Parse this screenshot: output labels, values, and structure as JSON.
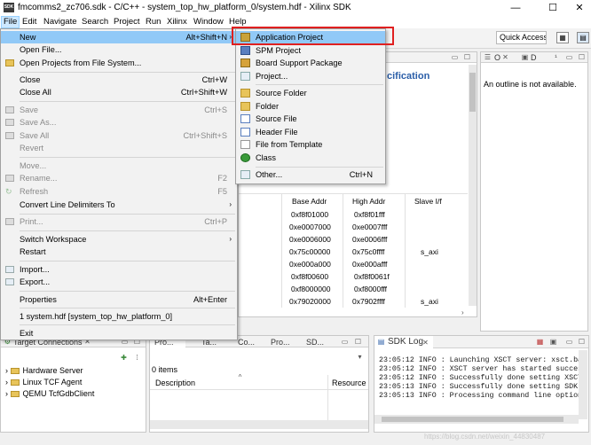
{
  "window": {
    "app_icon": "SDK",
    "title": "fmcomms2_zc706.sdk - C/C++ - system_top_hw_platform_0/system.hdf - Xilinx SDK",
    "minimize": "—",
    "maximize": "☐",
    "close": "✕"
  },
  "menubar": [
    "File",
    "Edit",
    "Navigate",
    "Search",
    "Project",
    "Run",
    "Xilinx",
    "Window",
    "Help"
  ],
  "toolbar": {
    "quick_access_placeholder": "Quick Access"
  },
  "file_menu": {
    "items": [
      {
        "label": "New",
        "shortcut": "Alt+Shift+N",
        "submenu": true,
        "highlighted": true
      },
      {
        "label": "Open File...",
        "shortcut": ""
      },
      {
        "label": "Open Projects from File System...",
        "shortcut": ""
      },
      {
        "label": "Close",
        "shortcut": "Ctrl+W"
      },
      {
        "label": "Close All",
        "shortcut": "Ctrl+Shift+W"
      },
      {
        "label": "Save",
        "shortcut": "Ctrl+S",
        "disabled": true
      },
      {
        "label": "Save As...",
        "shortcut": "",
        "disabled": true
      },
      {
        "label": "Save All",
        "shortcut": "Ctrl+Shift+S",
        "disabled": true
      },
      {
        "label": "Revert",
        "shortcut": "",
        "disabled": true
      },
      {
        "label": "Move...",
        "shortcut": "",
        "disabled": true
      },
      {
        "label": "Rename...",
        "shortcut": "F2",
        "disabled": true
      },
      {
        "label": "Refresh",
        "shortcut": "F5",
        "disabled": true
      },
      {
        "label": "Convert Line Delimiters To",
        "shortcut": "",
        "submenu": true
      },
      {
        "label": "Print...",
        "shortcut": "Ctrl+P",
        "disabled": true
      },
      {
        "label": "Switch Workspace",
        "shortcut": "",
        "submenu": true
      },
      {
        "label": "Restart",
        "shortcut": ""
      },
      {
        "label": "Import...",
        "shortcut": ""
      },
      {
        "label": "Export...",
        "shortcut": ""
      },
      {
        "label": "Properties",
        "shortcut": "Alt+Enter"
      },
      {
        "label": "1 system.hdf  [system_top_hw_platform_0]",
        "shortcut": ""
      },
      {
        "label": "Exit",
        "shortcut": ""
      }
    ]
  },
  "new_menu": {
    "items": [
      {
        "label": "Application Project",
        "shortcut": "",
        "highlighted": true
      },
      {
        "label": "SPM Project",
        "shortcut": ""
      },
      {
        "label": "Board Support Package",
        "shortcut": ""
      },
      {
        "label": "Project...",
        "shortcut": ""
      },
      {
        "label": "Source Folder",
        "shortcut": ""
      },
      {
        "label": "Folder",
        "shortcut": ""
      },
      {
        "label": "Source File",
        "shortcut": ""
      },
      {
        "label": "Header File",
        "shortcut": ""
      },
      {
        "label": "File from Template",
        "shortcut": ""
      },
      {
        "label": "Class",
        "shortcut": ""
      },
      {
        "label": "Other...",
        "shortcut": "Ctrl+N"
      }
    ]
  },
  "editor": {
    "heading_fragment": "cification",
    "columns": [
      "Base Addr",
      "High Addr",
      "Slave I/f"
    ],
    "rows": [
      [
        "0xf8f01000",
        "0xf8f01fff",
        ""
      ],
      [
        "0xe0007000",
        "0xe0007fff",
        ""
      ],
      [
        "0xe0006000",
        "0xe0006fff",
        ""
      ],
      [
        "0x75c00000",
        "0x75c0ffff",
        "s_axi"
      ],
      [
        "0xe000a000",
        "0xe000afff",
        ""
      ],
      [
        "0xf8f00600",
        "0xf8f0061f",
        ""
      ],
      [
        "0xf8000000",
        "0xf8000fff",
        ""
      ],
      [
        "0x79020000",
        "0x7902ffff",
        "s_axi"
      ]
    ]
  },
  "outline": {
    "tab1": "O",
    "tab2": "D",
    "message": "An outline is not available."
  },
  "target_connections": {
    "title": "Target Connections",
    "items": [
      "Hardware Server",
      "Linux TCF Agent",
      "QEMU TcfGdbClient"
    ]
  },
  "problems": {
    "tabs": [
      "Pro...",
      "Ta...",
      "Co...",
      "Pro...",
      "SD..."
    ],
    "count": "0 items",
    "columns": [
      "Description",
      "Resource"
    ]
  },
  "sdk_log": {
    "title": "SDK Log",
    "lines": [
      "23:05:12 INFO  : Launching XSCT server: xsct.ba",
      "23:05:12 INFO  : XSCT server has started succes",
      "23:05:12 INFO  : Successfully done setting XSCT",
      "23:05:13 INFO  : Successfully done setting SDK w",
      "23:05:13 INFO  : Processing command line option"
    ]
  },
  "watermark": "https://blog.csdn.net/weixin_44830487",
  "colors": {
    "highlight": "#91c9f7",
    "red_box": "#e02020",
    "heading_blue": "#2b5ea8"
  }
}
